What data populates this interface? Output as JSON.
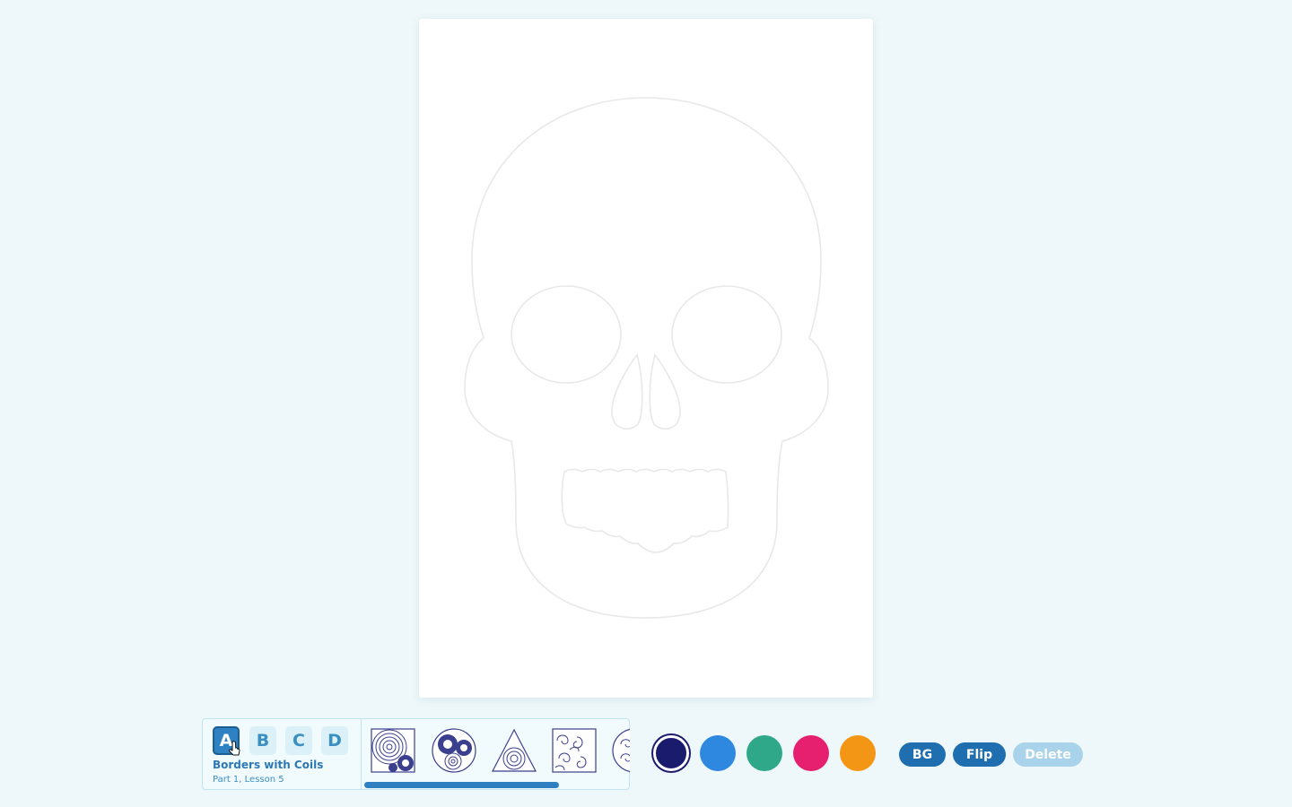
{
  "lesson_panel": {
    "tabs": [
      {
        "label": "A",
        "active": true
      },
      {
        "label": "B",
        "active": false
      },
      {
        "label": "C",
        "active": false
      },
      {
        "label": "D",
        "active": false
      }
    ],
    "title": "Borders with Coils",
    "subtitle": "Part 1, Lesson 5",
    "thumbnails": [
      "spiral-square-pattern-icon",
      "spiral-circle-pattern-icon",
      "spiral-triangle-pattern-icon",
      "swirl-square-pattern-icon",
      "swirl-circle-pattern-icon"
    ]
  },
  "colors": {
    "swatches": [
      "#1b1b6e",
      "#2e88e0",
      "#2fa88a",
      "#e61f6f",
      "#f39615"
    ],
    "selected_index": 0,
    "accent": "#1f6fb0",
    "background": "#eef8fa"
  },
  "actions": {
    "bg_label": "BG",
    "flip_label": "Flip",
    "delete_label": "Delete"
  },
  "canvas": {
    "template_icon": "skull-outline-icon"
  }
}
